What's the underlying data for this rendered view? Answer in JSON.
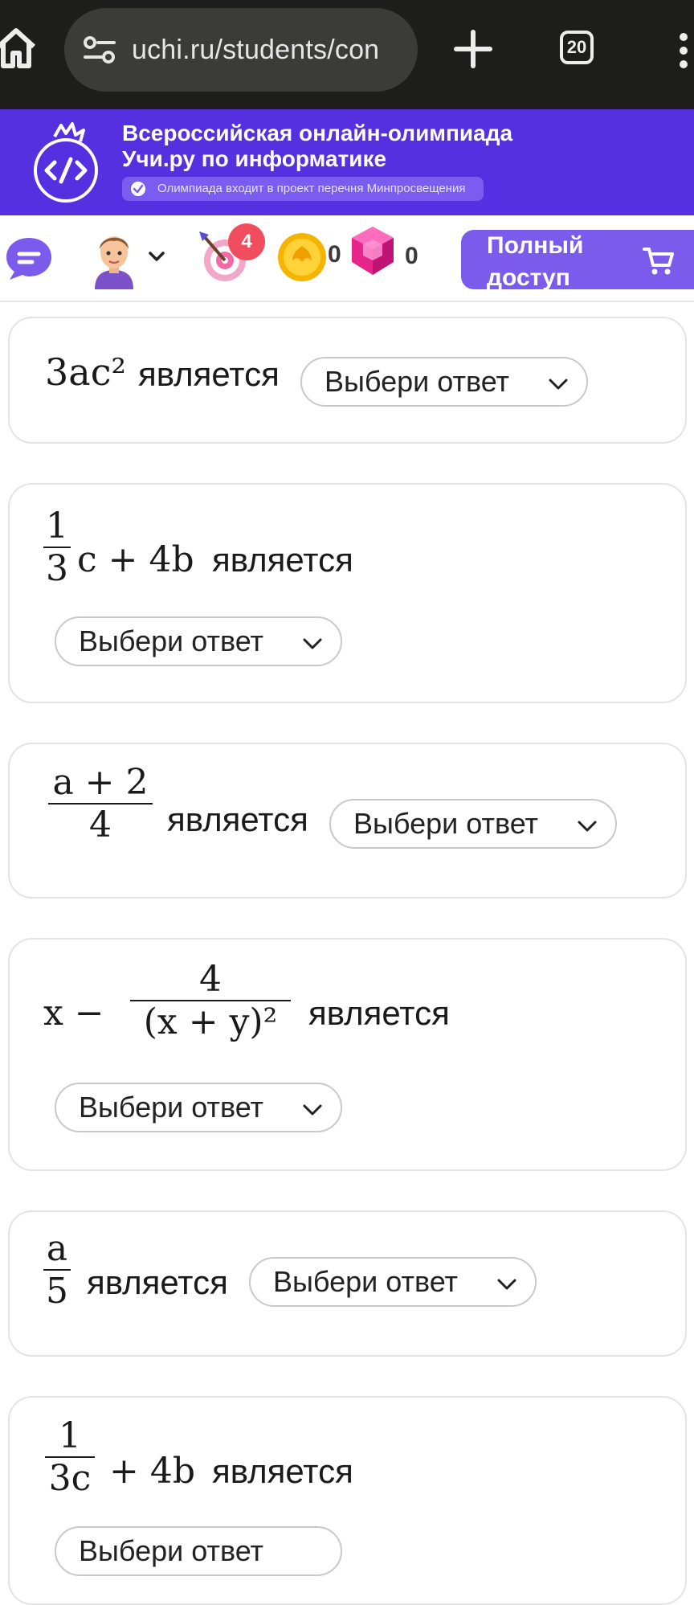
{
  "browser": {
    "url": "uchi.ru/students/con",
    "tab_count": "20"
  },
  "banner": {
    "title_line1": "Всероссийская онлайн-олимпиада",
    "title_line2": "Учи.ру по информатике",
    "badge": "Олимпиада входит в проект перечня Минпросвещения"
  },
  "toolbar": {
    "target_badge": "4",
    "coins": "0",
    "gems": "0",
    "full_access_label": "Полный доступ"
  },
  "common": {
    "is_label": "является",
    "select_placeholder": "Выбери ответ"
  },
  "cards": [
    {
      "expr": "3ac²"
    },
    {
      "expr": "1/3 c + 4b",
      "num": "1",
      "den": "3",
      "tail": "c + 4b"
    },
    {
      "expr": "(a + 2)/4",
      "num": "a + 2",
      "den": "4"
    },
    {
      "expr": "x − 4/(x + y)²",
      "head": "x −",
      "num": "4",
      "den": "(x + y)²"
    },
    {
      "expr": "a/5",
      "num": "a",
      "den": "5"
    },
    {
      "expr": "1/(3c) + 4b",
      "num": "1",
      "den": "3c",
      "tail": "+ 4b"
    }
  ],
  "colors": {
    "browser_bg": "#1d1d1b",
    "banner_bg": "#5430e0",
    "accent": "#7a5bec",
    "badge_red": "#f04e5e"
  }
}
